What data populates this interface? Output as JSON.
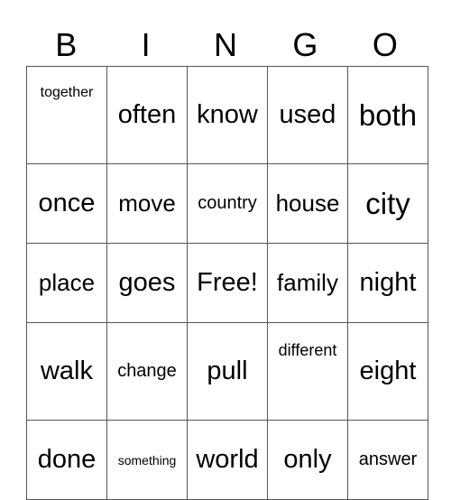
{
  "header": [
    "B",
    "I",
    "N",
    "G",
    "O"
  ],
  "rows": [
    [
      "together",
      "often",
      "know",
      "used",
      "both"
    ],
    [
      "once",
      "move",
      "country",
      "house",
      "city"
    ],
    [
      "place",
      "goes",
      "Free!",
      "family",
      "night"
    ],
    [
      "walk",
      "change",
      "pull",
      "different",
      "eight"
    ],
    [
      "done",
      "something",
      "world",
      "only",
      "answer"
    ]
  ]
}
